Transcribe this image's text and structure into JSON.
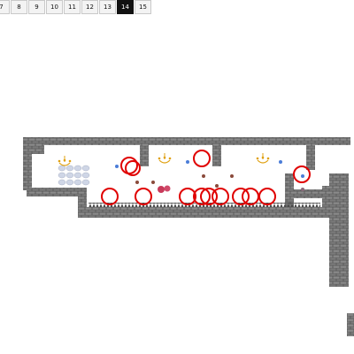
{
  "level_tabs": [
    {
      "label": "7",
      "active": false
    },
    {
      "label": "8",
      "active": false
    },
    {
      "label": "9",
      "active": false
    },
    {
      "label": "10",
      "active": false
    },
    {
      "label": "11",
      "active": false
    },
    {
      "label": "12",
      "active": false
    },
    {
      "label": "13",
      "active": false
    },
    {
      "label": "14",
      "active": true
    },
    {
      "label": "15",
      "active": false
    }
  ],
  "colors": {
    "brick": "#5f5f5f",
    "brick_light": "#8a8a8a",
    "spike": "#4a4a4a",
    "target_ring": "#e00000",
    "chandelier": "#e0a010",
    "gem_blue": "#4b7dd8",
    "gem_brown": "#8a4a3a",
    "pink_bubble": "#c83a5a",
    "ghost_stack": "#cfd6e6"
  },
  "icons": {
    "chandelier": "chandelier-icon",
    "spike": "spike-icon",
    "ring": "target-ring-icon",
    "gem": "gem-icon"
  }
}
